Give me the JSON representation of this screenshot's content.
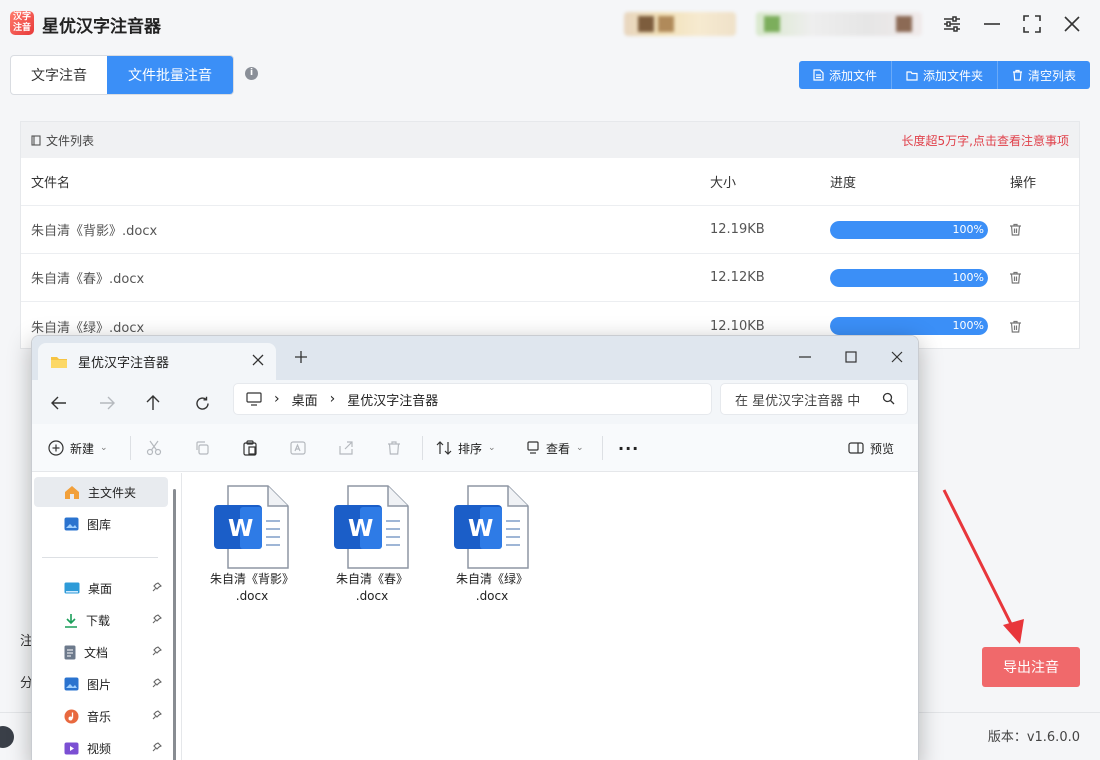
{
  "app": {
    "title": "星优汉字注音器",
    "logo_text": "汉字注音",
    "tabs": [
      {
        "label": "文字注音",
        "active": false
      },
      {
        "label": "文件批量注音",
        "active": true
      }
    ],
    "toolbar": {
      "add_file": "添加文件",
      "add_folder": "添加文件夹",
      "clear_list": "清空列表"
    },
    "file_list": {
      "title": "文件列表",
      "warning": "长度超5万字,点击查看注意事项",
      "columns": {
        "name": "文件名",
        "size": "大小",
        "progress": "进度",
        "action": "操作"
      },
      "rows": [
        {
          "name": "朱自清《背影》.docx",
          "size": "12.19KB",
          "progress": 100,
          "progress_label": "100%"
        },
        {
          "name": "朱自清《春》.docx",
          "size": "12.12KB",
          "progress": 100,
          "progress_label": "100%"
        },
        {
          "name": "朱自清《绿》.docx",
          "size": "12.10KB",
          "progress": 100,
          "progress_label": "100%"
        }
      ]
    },
    "side_labels": {
      "label1": "注",
      "label2": "分"
    },
    "export_button": "导出注音",
    "version": "版本：v1.6.0.0",
    "accent_color": "#3b8ff7",
    "export_color": "#f0696b"
  },
  "explorer": {
    "tab_title": "星优汉字注音器",
    "breadcrumb": [
      "桌面",
      "星优汉字注音器"
    ],
    "search_placeholder": "在 星优汉字注音器 中",
    "commands": {
      "new": "新建",
      "sort": "排序",
      "view": "查看",
      "preview": "预览"
    },
    "sidebar": {
      "home": "主文件夹",
      "gallery": "图库",
      "desktop": "桌面",
      "downloads": "下载",
      "documents": "文档",
      "pictures": "图片",
      "music": "音乐",
      "videos": "视频"
    },
    "files": [
      {
        "line1": "朱自清《背影》",
        "line2": ".docx"
      },
      {
        "line1": "朱自清《春》",
        "line2": ".docx"
      },
      {
        "line1": "朱自清《绿》",
        "line2": ".docx"
      }
    ]
  }
}
